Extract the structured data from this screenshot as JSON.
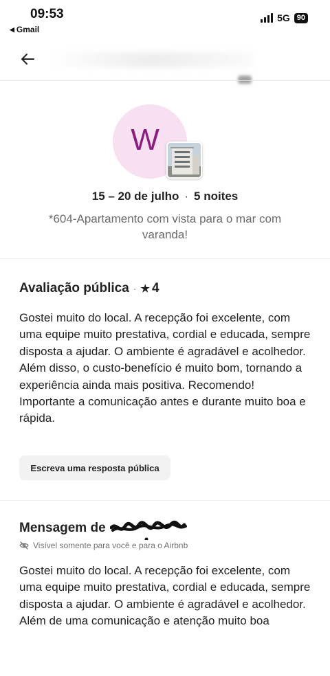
{
  "status_bar": {
    "time": "09:53",
    "back_app": "Gmail",
    "network": "5G",
    "battery": "90"
  },
  "listing": {
    "host_initial": "W",
    "dates": "15 – 20 de julho",
    "nights": "5 noites",
    "name": "*604-Apartamento com vista para o mar com varanda!"
  },
  "review": {
    "heading": "Avaliação pública",
    "rating": "4",
    "paragraph_1": "Gostei muito do local. A recepção foi excelente, com uma equipe muito prestativa, cordial e educada, sempre disposta a ajudar. O ambiente é agradável e acolhedor. Além disso, o custo-benefício é muito bom, tornando a experiência ainda mais positiva. Recomendo!",
    "paragraph_2": "Importante a comunicação antes e durante muito boa e rápida.",
    "reply_button": "Escreva uma resposta pública"
  },
  "message": {
    "heading_prefix": "Mensagem de",
    "privacy_note": "Visível somente para você e para o Airbnb",
    "body": "Gostei muito do local. A recepção foi excelente, com uma equipe muito prestativa, cordial e educada, sempre disposta a ajudar. O ambiente é agradável e acolhedor.  Além de uma comunicação e atenção muito boa"
  },
  "colors": {
    "avatar_bg": "#f6e0f1",
    "avatar_letter": "#8a1f7f",
    "text_primary": "#222222",
    "text_secondary": "#6a6a6a",
    "button_bg": "#f2f2f2"
  },
  "icons": {
    "back": "arrow-left-icon",
    "star": "star-icon",
    "privacy": "eye-off-icon",
    "signal": "signal-icon"
  }
}
